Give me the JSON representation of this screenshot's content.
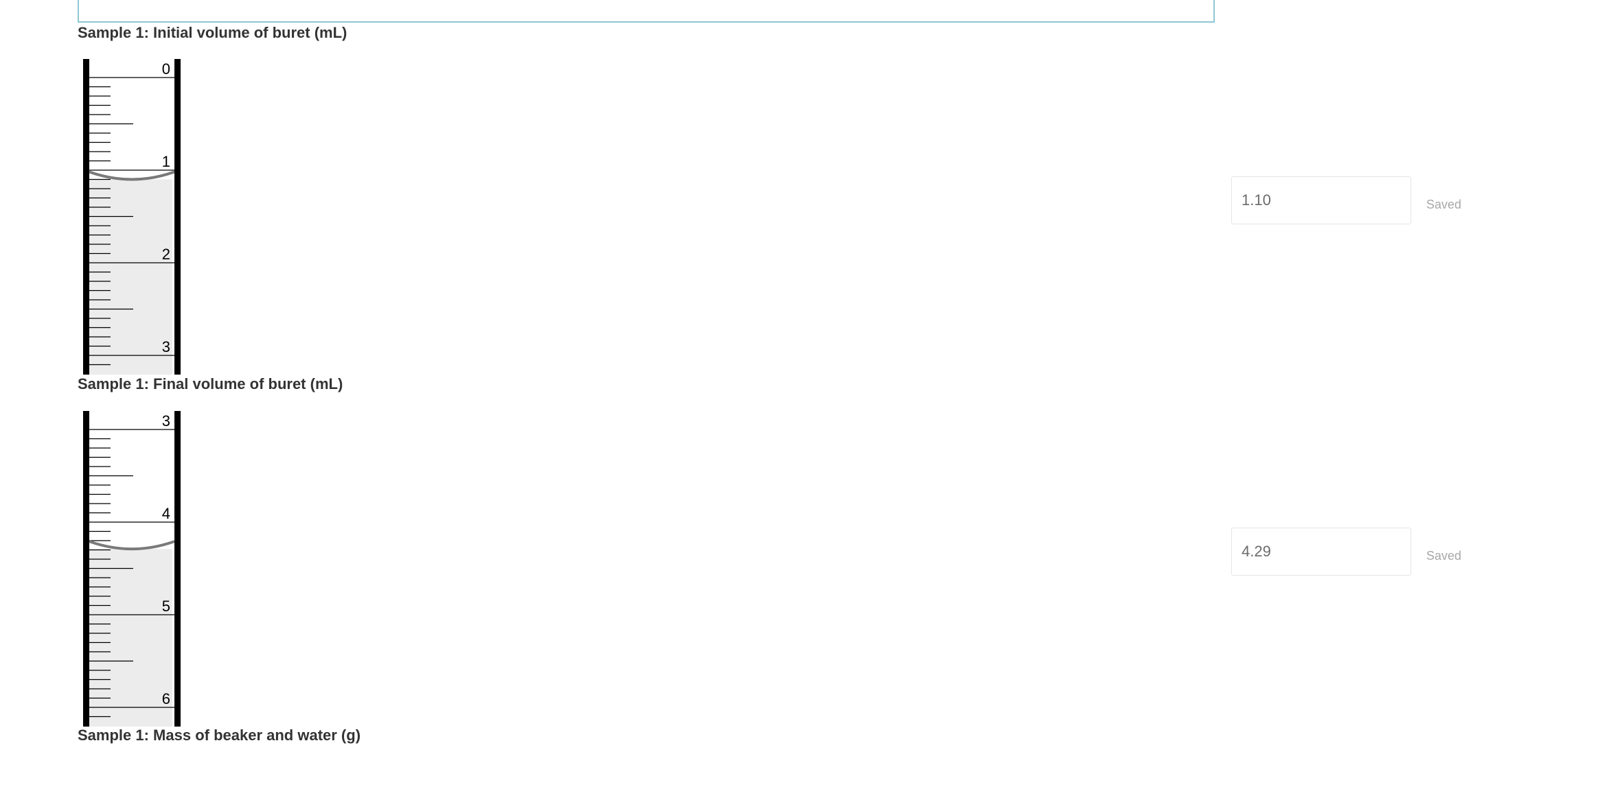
{
  "questions": [
    {
      "label": "Sample 1: Initial volume of buret (mL)",
      "buret": {
        "start": 0,
        "level": 1.1,
        "tick_labels": [
          "0",
          "1",
          "2",
          "3"
        ]
      },
      "answer": {
        "value": "1.10",
        "status": "Saved"
      }
    },
    {
      "label": "Sample 1: Final volume of buret (mL)",
      "buret": {
        "start": 3,
        "level": 4.29,
        "tick_labels": [
          "3",
          "4",
          "5",
          "6"
        ]
      },
      "answer": {
        "value": "4.29",
        "status": "Saved"
      }
    },
    {
      "label": "Sample 1: Mass of beaker and water (g)"
    }
  ],
  "colors": {
    "liquid": "#ececec",
    "meniscus": "#7a7a7a",
    "wall": "#000000",
    "input_border": "#e5e5e5",
    "top_box_border": "#8ec7d4",
    "label_text": "#333333",
    "status_text": "#a8a8a8"
  }
}
